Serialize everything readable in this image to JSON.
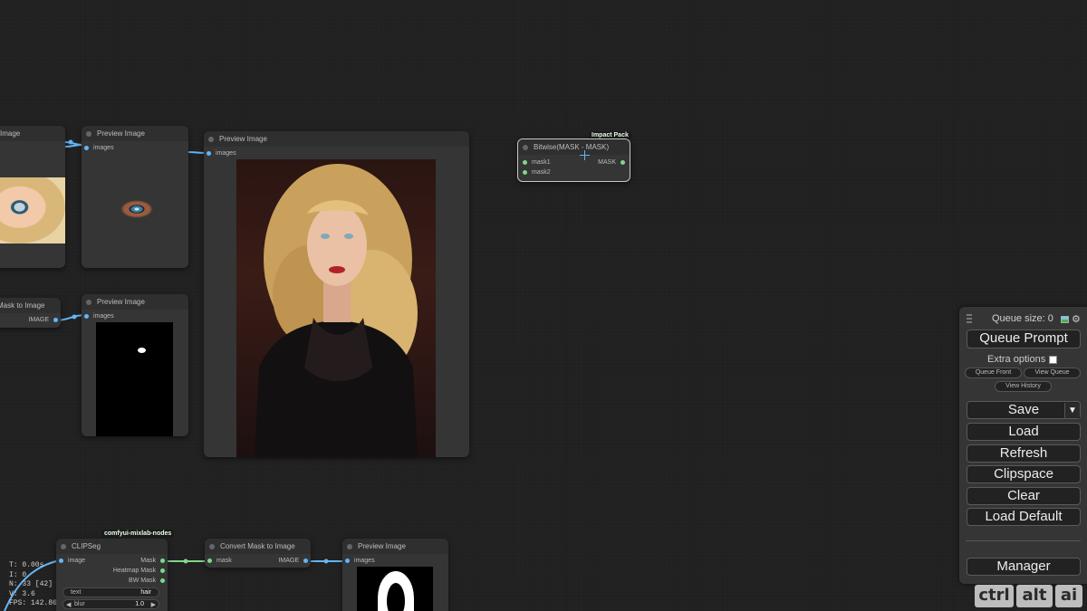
{
  "nodes": {
    "partial_image": {
      "title": "Image"
    },
    "preview1": {
      "title": "Preview Image",
      "input": "images"
    },
    "preview_main": {
      "title": "Preview Image",
      "input": "images"
    },
    "mask_to_image_partial": {
      "title": "Mask to Image",
      "output": "IMAGE"
    },
    "preview2": {
      "title": "Preview Image",
      "input": "images"
    },
    "bitwise": {
      "title": "Bitwise(MASK - MASK)",
      "pack": "Impact Pack",
      "inputs": [
        "mask1",
        "mask2"
      ],
      "output": "MASK"
    },
    "clipseg": {
      "title": "CLIPSeg",
      "pack": "comfyui-mixlab-nodes",
      "input": "image",
      "outputs": [
        "Mask",
        "Heatmap Mask",
        "BW Mask"
      ],
      "widgets": [
        {
          "label": "text",
          "value": "hair"
        },
        {
          "label": "blur",
          "value": "1.0"
        }
      ]
    },
    "convert_mask": {
      "title": "Convert Mask to Image",
      "input": "mask",
      "output": "IMAGE"
    },
    "preview3": {
      "title": "Preview Image",
      "input": "images"
    }
  },
  "stats": [
    "T: 0.00s",
    "I: 0",
    "N: 33 [42]",
    "V: 3.6",
    "FPS: 142.86"
  ],
  "panel": {
    "queue_size": "Queue size: 0",
    "queue_prompt": "Queue Prompt",
    "extra_options": "Extra options",
    "queue_front": "Queue Front",
    "view_queue": "View Queue",
    "view_history": "View History",
    "save": "Save",
    "save_arrow": "▼",
    "load": "Load",
    "refresh": "Refresh",
    "clipspace": "Clipspace",
    "clear": "Clear",
    "load_default": "Load Default",
    "manager": "Manager"
  },
  "keys": [
    "ctrl",
    "alt",
    "ai"
  ],
  "colors": {
    "wire_blue": "#64b5f6",
    "wire_green": "#7fd88a",
    "node_bg": "#353535"
  }
}
